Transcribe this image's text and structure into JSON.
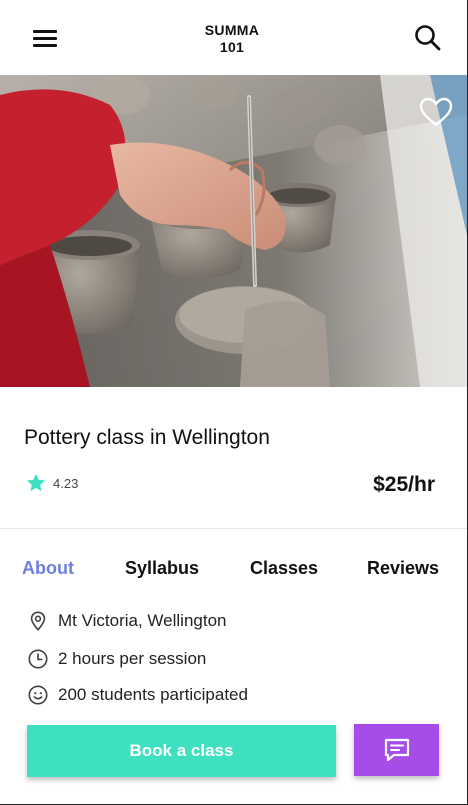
{
  "header": {
    "logo_line1": "SUMMA",
    "logo_line2": "101",
    "menu_icon": "hamburger-menu-icon",
    "search_icon": "search-icon"
  },
  "hero": {
    "image_subject": "pottery class",
    "favorite_icon": "heart-outline-icon"
  },
  "listing": {
    "title": "Pottery class in Wellington",
    "rating": "4.23",
    "price": "$25/hr",
    "star_color": "#3ddfc0"
  },
  "tabs": [
    {
      "label": "About",
      "active": true
    },
    {
      "label": "Syllabus",
      "active": false
    },
    {
      "label": "Classes",
      "active": false
    },
    {
      "label": "Reviews",
      "active": false
    }
  ],
  "details": [
    {
      "icon": "location-pin-icon",
      "text": "Mt Victoria, Wellington"
    },
    {
      "icon": "clock-icon",
      "text": "2 hours per session"
    },
    {
      "icon": "smiley-icon",
      "text": "200 students participated"
    }
  ],
  "actions": {
    "book_label": "Book a class",
    "book_color": "#3fe0bf",
    "message_icon": "chat-message-icon",
    "message_color": "#a64de8"
  },
  "colors": {
    "accent": "#6f7ee0"
  }
}
